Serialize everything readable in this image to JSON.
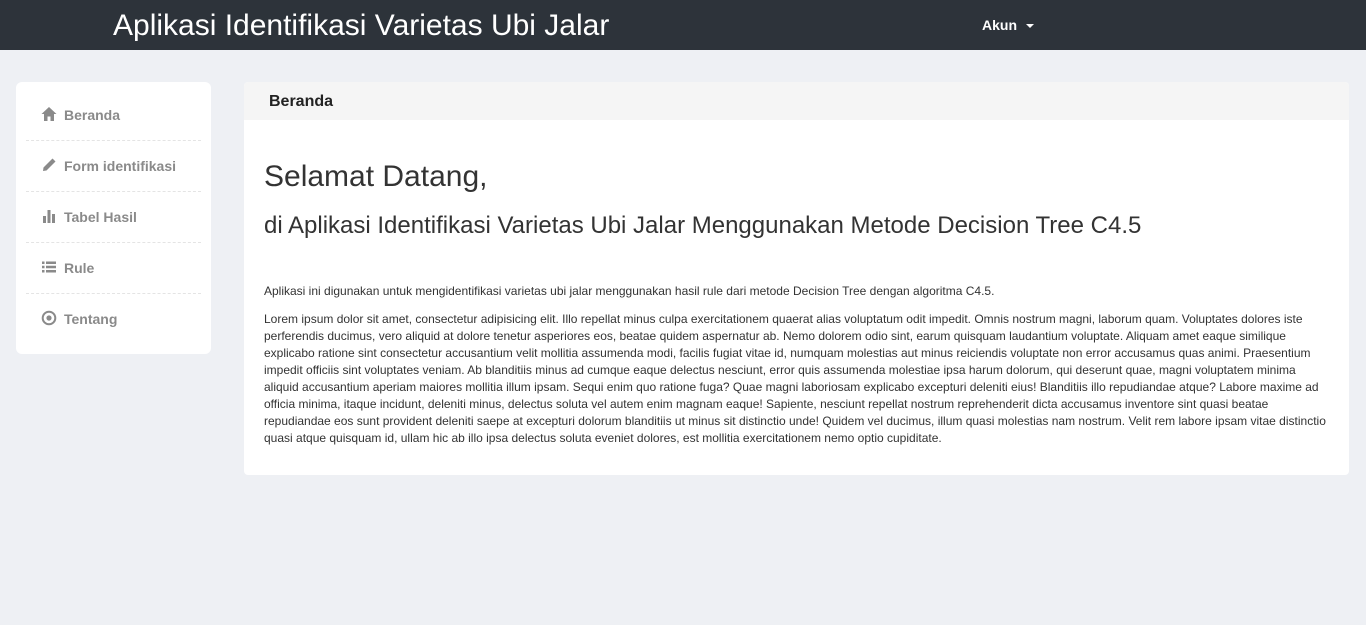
{
  "header": {
    "title": "Aplikasi Identifikasi Varietas Ubi Jalar",
    "account_label": "Akun",
    "background": "#2d333a"
  },
  "sidebar": {
    "items": [
      {
        "label": "Beranda",
        "icon": "home-icon"
      },
      {
        "label": "Form identifikasi",
        "icon": "pencil-icon"
      },
      {
        "label": "Tabel Hasil",
        "icon": "bar-chart-icon"
      },
      {
        "label": "Rule",
        "icon": "list-icon"
      },
      {
        "label": "Tentang",
        "icon": "record-icon"
      }
    ]
  },
  "main": {
    "panel_title": "Beranda",
    "welcome": "Selamat Datang,",
    "subtitle": "di Aplikasi Identifikasi Varietas Ubi Jalar Menggunakan Metode Decision Tree C4.5",
    "intro": "Aplikasi ini digunakan untuk mengidentifikasi varietas ubi jalar menggunakan hasil rule dari metode Decision Tree dengan algoritma C4.5.",
    "lorem": "Lorem ipsum dolor sit amet, consectetur adipisicing elit. Illo repellat minus culpa exercitationem quaerat alias voluptatum odit impedit. Omnis nostrum magni, laborum quam. Voluptates dolores iste perferendis ducimus, vero aliquid at dolore tenetur asperiores eos, beatae quidem aspernatur ab. Nemo dolorem odio sint, earum quisquam laudantium voluptate. Aliquam amet eaque similique explicabo ratione sint consectetur accusantium velit mollitia assumenda modi, facilis fugiat vitae id, numquam molestias aut minus reiciendis voluptate non error accusamus quas animi. Praesentium impedit officiis sint voluptates veniam. Ab blanditiis minus ad cumque eaque delectus nesciunt, error quis assumenda molestiae ipsa harum dolorum, qui deserunt quae, magni voluptatem minima aliquid accusantium aperiam maiores mollitia illum ipsam. Sequi enim quo ratione fuga? Quae magni laboriosam explicabo excepturi deleniti eius! Blanditiis illo repudiandae atque? Labore maxime ad officia minima, itaque incidunt, deleniti minus, delectus soluta vel autem enim magnam eaque! Sapiente, nesciunt repellat nostrum reprehenderit dicta accusamus inventore sint quasi beatae repudiandae eos sunt provident deleniti saepe at excepturi dolorum blanditiis ut minus sit distinctio unde! Quidem vel ducimus, illum quasi molestias nam nostrum. Velit rem labore ipsam vitae distinctio quasi atque quisquam id, ullam hic ab illo ipsa delectus soluta eveniet dolores, est mollitia exercitationem nemo optio cupiditate."
  }
}
